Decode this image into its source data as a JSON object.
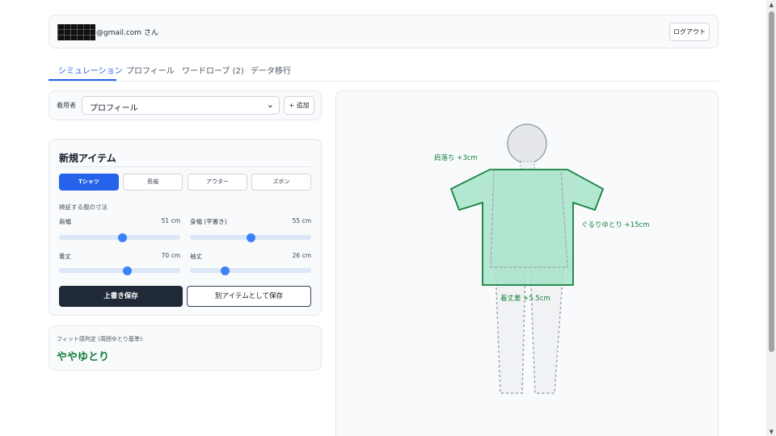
{
  "header": {
    "email": "@gmail.com さん",
    "logout_label": "ログアウト"
  },
  "tabs": [
    {
      "label": "シミュレーション",
      "active": true
    },
    {
      "label": "プロフィール",
      "active": false
    },
    {
      "label": "ワードローブ (2)",
      "active": false
    },
    {
      "label": "データ移行",
      "active": false
    }
  ],
  "wearer": {
    "label": "着用者",
    "selected_profile": "プロフィール",
    "add_label": "+ 追加"
  },
  "item": {
    "title": "新規アイテム",
    "types": [
      {
        "label": "Tシャツ",
        "active": true
      },
      {
        "label": "長袖",
        "active": false
      },
      {
        "label": "アウター",
        "active": false
      },
      {
        "label": "ズボン",
        "active": false
      }
    ],
    "dimensions_label": "検証する服の寸法",
    "sliders": [
      {
        "name": "肩幅",
        "value_label": "51 cm",
        "fill_fraction": 0.52
      },
      {
        "name": "身幅 (平置き)",
        "value_label": "55 cm",
        "fill_fraction": 0.5
      },
      {
        "name": "着丈",
        "value_label": "70 cm",
        "fill_fraction": 0.56
      },
      {
        "name": "袖丈",
        "value_label": "26 cm",
        "fill_fraction": 0.29
      }
    ],
    "save_label": "上書き保存",
    "save_as_label": "別アイテムとして保存"
  },
  "fit": {
    "label": "フィット感判定 (周囲ゆとり基準):",
    "value": "ややゆとり"
  },
  "visualization": {
    "shoulder_label": "肩落ち +3cm",
    "girth_label": "ぐるりゆとり +15cm",
    "length_label": "着丈差 +5.5cm",
    "garment_fill": "#a7e3c9",
    "garment_stroke": "#15803d"
  },
  "colors": {
    "accent": "#2563eb",
    "fit_good": "#15803d"
  }
}
